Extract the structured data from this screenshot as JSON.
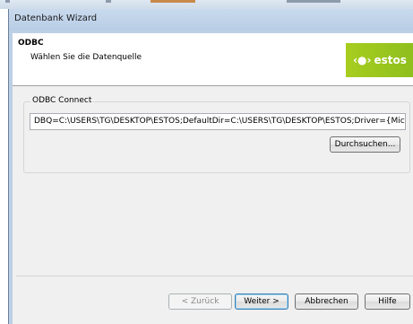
{
  "window": {
    "title": "Datenbank Wizard"
  },
  "header": {
    "title": "ODBC",
    "subtitle": "Wählen Sie die Datenquelle",
    "logo": {
      "mark": "‹●›",
      "text": "estos",
      "color": "#9ac81e"
    }
  },
  "odbc_group": {
    "legend": "ODBC Connect",
    "connection_string": "DBQ=C:\\USERS\\TG\\DESKTOP\\ESTOS;DefaultDir=C:\\USERS\\TG\\DESKTOP\\ESTOS;Driver={Microsoft Te",
    "browse_label": "Durchsuchen..."
  },
  "footer": {
    "back_label": "< Zurück",
    "next_label": "Weiter >",
    "cancel_label": "Abbrechen",
    "help_label": "Hilfe"
  }
}
